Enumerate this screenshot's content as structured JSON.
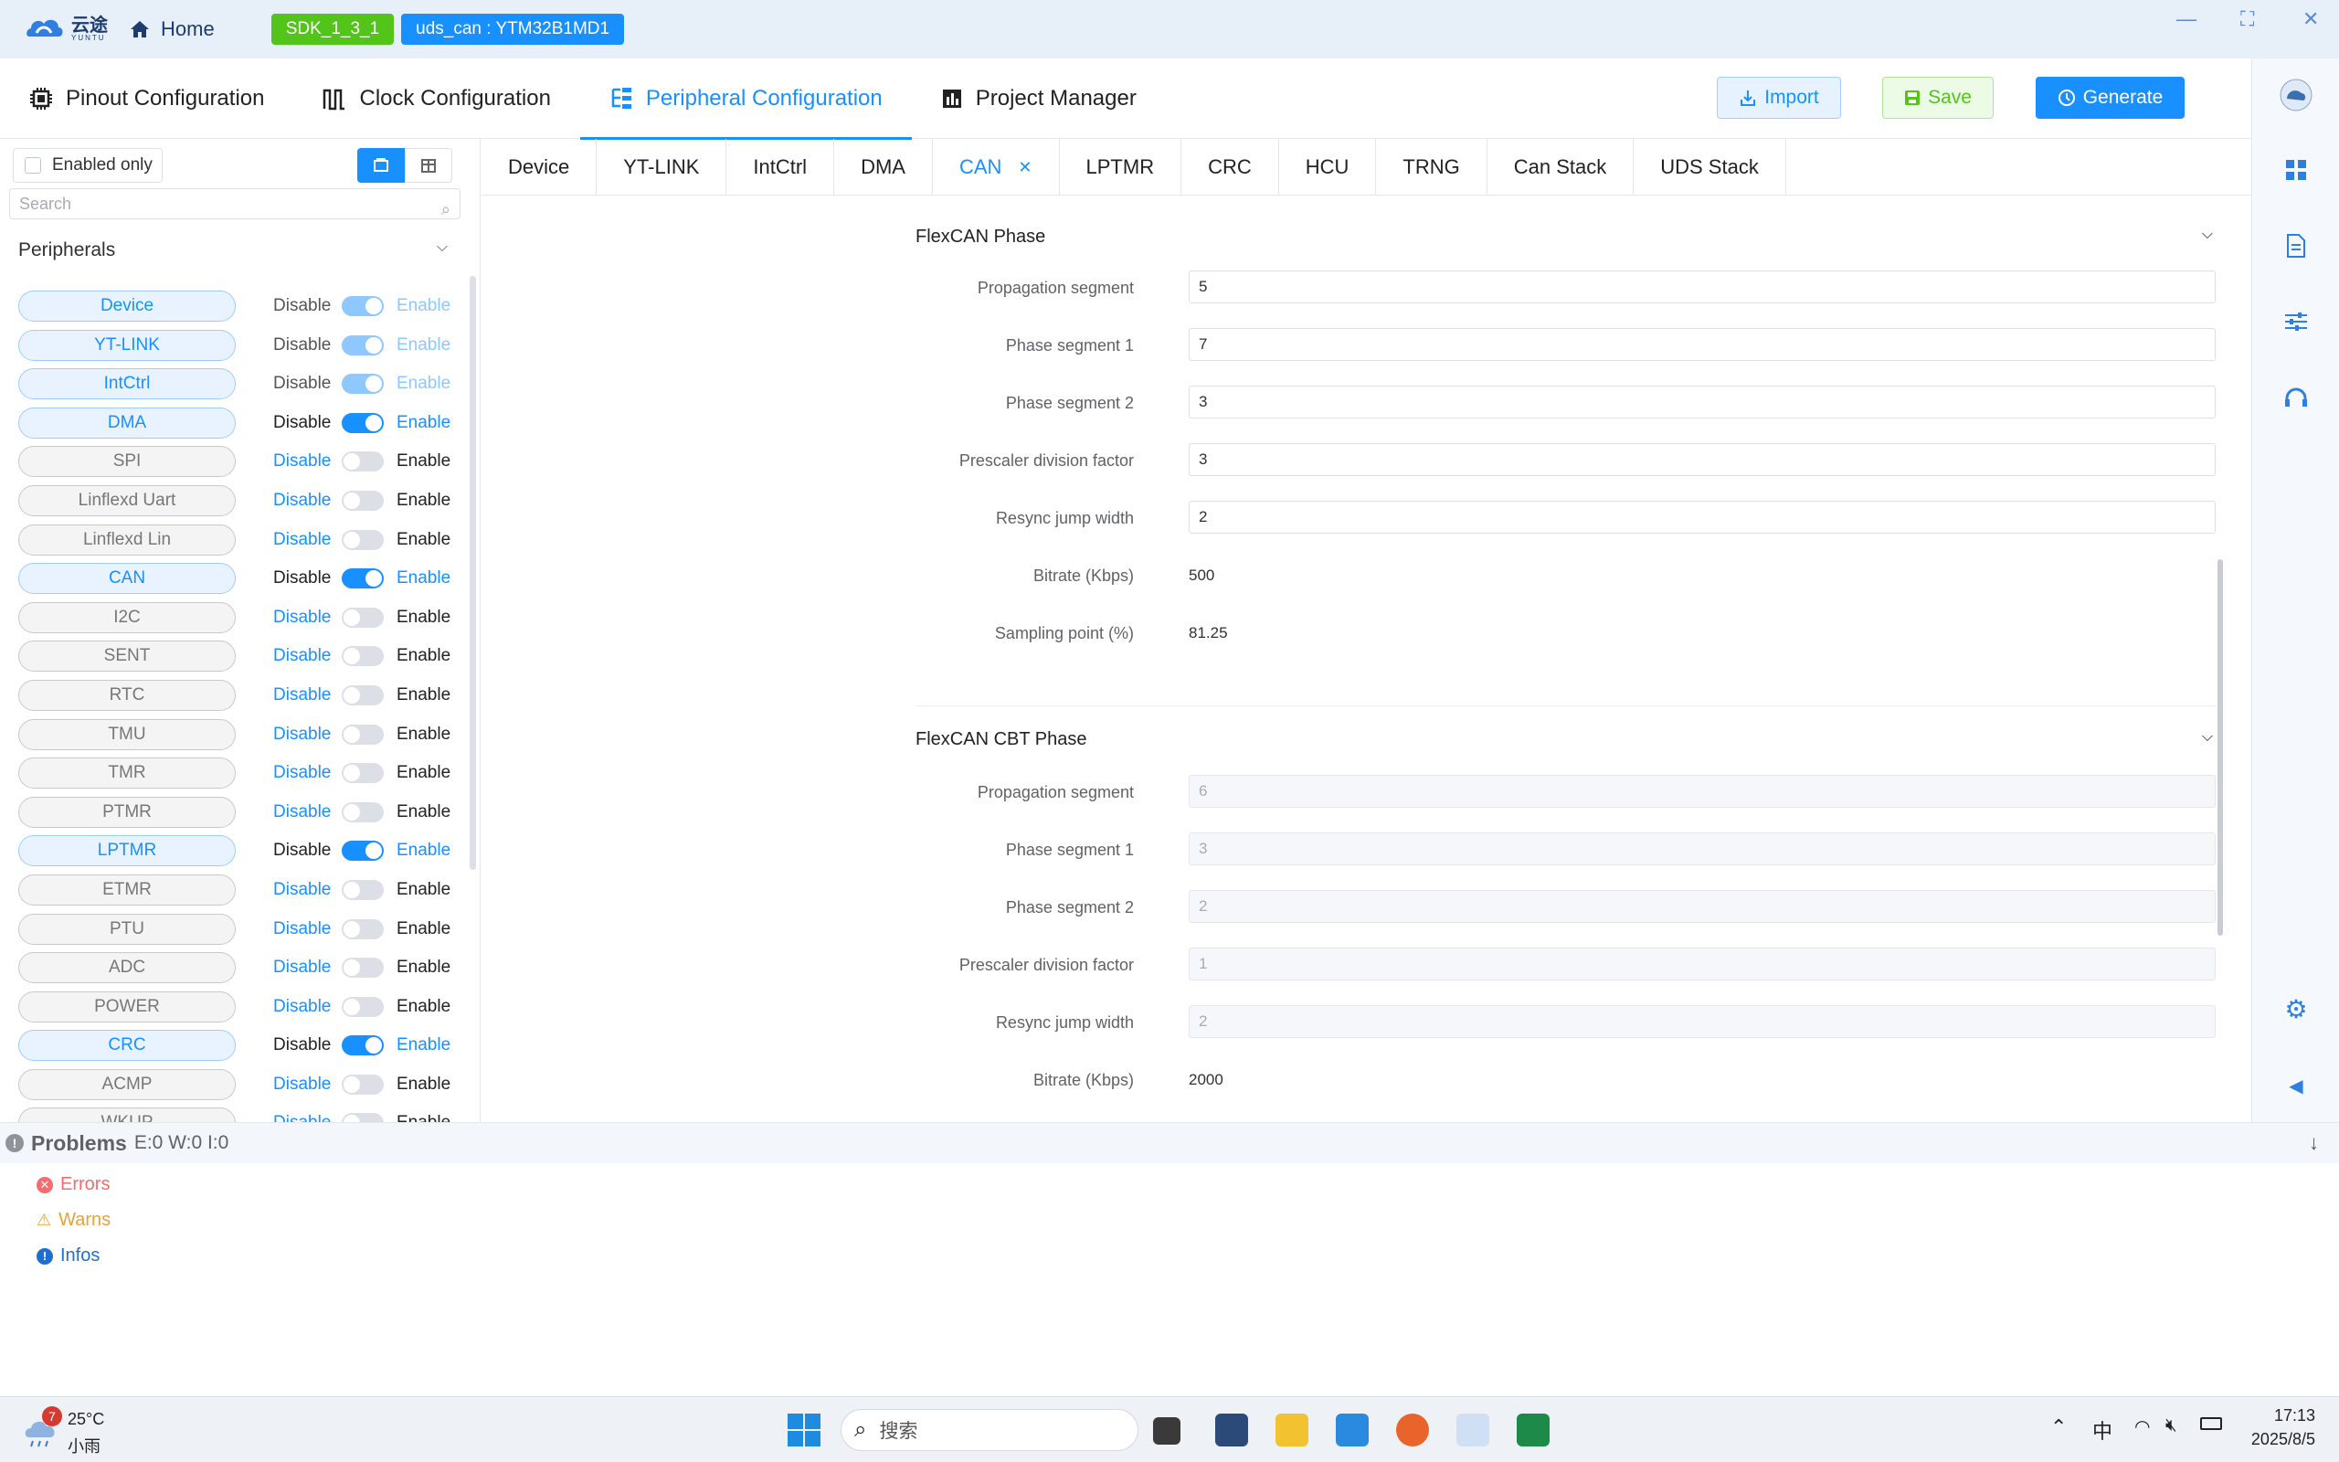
{
  "titlebar": {
    "logo_text": "云途",
    "logo_sub": "YUNTU",
    "home_label": "Home",
    "sdk_badge": "SDK_1_3_1",
    "project_badge": "uds_can : YTM32B1MD1"
  },
  "nav": {
    "tabs": [
      {
        "label": "Pinout Configuration",
        "icon": "chip-icon"
      },
      {
        "label": "Clock Configuration",
        "icon": "clock-wave-icon"
      },
      {
        "label": "Peripheral Configuration",
        "icon": "peripheral-tree-icon",
        "active": true
      },
      {
        "label": "Project Manager",
        "icon": "chart-book-icon"
      }
    ],
    "import_label": "Import",
    "save_label": "Save",
    "generate_label": "Generate"
  },
  "left": {
    "enabled_only": "Enabled only",
    "search_placeholder": "Search",
    "peripherals_title": "Peripherals",
    "disable_label": "Disable",
    "enable_label": "Enable",
    "items": [
      {
        "name": "Device",
        "state": "locked"
      },
      {
        "name": "YT-LINK",
        "state": "locked"
      },
      {
        "name": "IntCtrl",
        "state": "locked"
      },
      {
        "name": "DMA",
        "state": "on"
      },
      {
        "name": "SPI",
        "state": "off"
      },
      {
        "name": "Linflexd Uart",
        "state": "off"
      },
      {
        "name": "Linflexd Lin",
        "state": "off"
      },
      {
        "name": "CAN",
        "state": "on"
      },
      {
        "name": "I2C",
        "state": "off"
      },
      {
        "name": "SENT",
        "state": "off"
      },
      {
        "name": "RTC",
        "state": "off"
      },
      {
        "name": "TMU",
        "state": "off"
      },
      {
        "name": "TMR",
        "state": "off"
      },
      {
        "name": "PTMR",
        "state": "off"
      },
      {
        "name": "LPTMR",
        "state": "on"
      },
      {
        "name": "ETMR",
        "state": "off"
      },
      {
        "name": "PTU",
        "state": "off"
      },
      {
        "name": "ADC",
        "state": "off"
      },
      {
        "name": "POWER",
        "state": "off"
      },
      {
        "name": "CRC",
        "state": "on"
      },
      {
        "name": "ACMP",
        "state": "off"
      },
      {
        "name": "WKUP",
        "state": "off"
      }
    ]
  },
  "main": {
    "tabs": [
      "Device",
      "YT-LINK",
      "IntCtrl",
      "DMA",
      "CAN",
      "LPTMR",
      "CRC",
      "HCU",
      "TRNG",
      "Can Stack",
      "UDS Stack"
    ],
    "active_tab": "CAN",
    "flexcan_phase": {
      "title": "FlexCAN Phase",
      "fields": [
        {
          "label": "Propagation segment",
          "value": "5",
          "kind": "input"
        },
        {
          "label": "Phase segment 1",
          "value": "7",
          "kind": "input"
        },
        {
          "label": "Phase segment 2",
          "value": "3",
          "kind": "input"
        },
        {
          "label": "Prescaler division factor",
          "value": "3",
          "kind": "input"
        },
        {
          "label": "Resync jump width",
          "value": "2",
          "kind": "input"
        },
        {
          "label": "Bitrate (Kbps)",
          "value": "500",
          "kind": "text"
        },
        {
          "label": "Sampling point (%)",
          "value": "81.25",
          "kind": "text"
        }
      ]
    },
    "flexcan_cbt_phase": {
      "title": "FlexCAN CBT Phase",
      "fields": [
        {
          "label": "Propagation segment",
          "value": "6",
          "kind": "disabled"
        },
        {
          "label": "Phase segment 1",
          "value": "3",
          "kind": "disabled"
        },
        {
          "label": "Phase segment 2",
          "value": "2",
          "kind": "disabled"
        },
        {
          "label": "Prescaler division factor",
          "value": "1",
          "kind": "disabled"
        },
        {
          "label": "Resync jump width",
          "value": "2",
          "kind": "disabled"
        },
        {
          "label": "Bitrate (Kbps)",
          "value": "2000",
          "kind": "text"
        }
      ]
    }
  },
  "problems": {
    "title": "Problems",
    "counts": "E:0 W:0 I:0",
    "errors": "Errors",
    "warns": "Warns",
    "infos": "Infos"
  },
  "taskbar": {
    "weather_badge": "7",
    "temperature": "25°C",
    "condition": "小雨",
    "search_placeholder": "搜索",
    "ime": "中",
    "time": "17:13",
    "date": "2025/8/5"
  },
  "colors": {
    "accent": "#1890ff",
    "success": "#52c41a",
    "error": "#f56c6c",
    "warning": "#e6a23c"
  }
}
